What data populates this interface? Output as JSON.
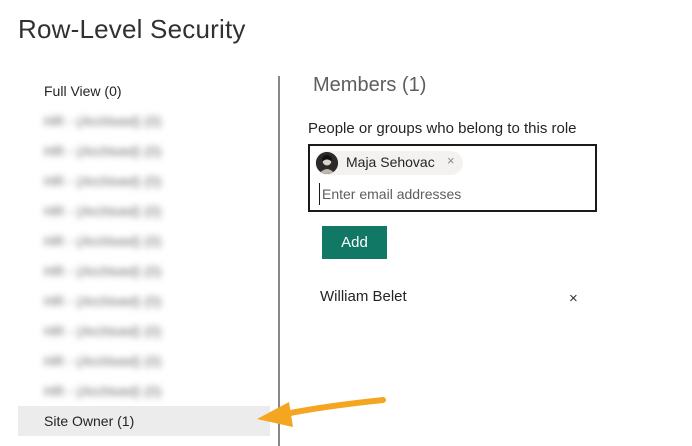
{
  "page": {
    "title": "Row-Level Security"
  },
  "roles": [
    {
      "label": "Full View (0)",
      "blurred": false,
      "selected": false
    },
    {
      "label": "HR - (Archived) (0)",
      "blurred": true,
      "selected": false
    },
    {
      "label": "HR - (Archived) (0)",
      "blurred": true,
      "selected": false
    },
    {
      "label": "HR - (Archived) (0)",
      "blurred": true,
      "selected": false
    },
    {
      "label": "HR - (Archived) (0)",
      "blurred": true,
      "selected": false
    },
    {
      "label": "HR - (Archived) (0)",
      "blurred": true,
      "selected": false
    },
    {
      "label": "HR - (Archived) (0)",
      "blurred": true,
      "selected": false
    },
    {
      "label": "HR - (Archived) (0)",
      "blurred": true,
      "selected": false
    },
    {
      "label": "HR - (Archived) (0)",
      "blurred": true,
      "selected": false
    },
    {
      "label": "HR - (Archived) (0)",
      "blurred": true,
      "selected": false
    },
    {
      "label": "HR - (Archived) (0)",
      "blurred": true,
      "selected": false
    },
    {
      "label": "Site Owner (1)",
      "blurred": false,
      "selected": true
    }
  ],
  "members": {
    "title": "Members (1)",
    "label": "People or groups who belong to this role",
    "chip": {
      "name": "Maja Sehovac",
      "remove_icon": "×"
    },
    "input_placeholder": "Enter email addresses",
    "add_label": "Add",
    "list": [
      {
        "name": "William Belet",
        "remove_icon": "×"
      }
    ]
  },
  "colors": {
    "accent": "#117865",
    "arrow": "#f4a620",
    "selected_bg": "#ececec"
  }
}
